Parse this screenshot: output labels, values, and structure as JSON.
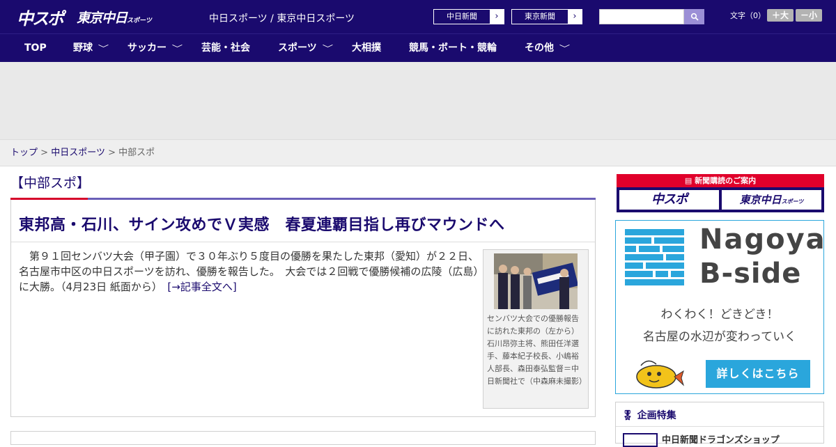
{
  "header": {
    "logo_chuspo": "中スポ",
    "logo_tokyo": "東京中日",
    "logo_tokyo_small": "スポーツ",
    "site_title": "中日スポーツ / 東京中日スポーツ",
    "paper_links": [
      {
        "label": "中日新聞"
      },
      {
        "label": "東京新聞"
      }
    ],
    "search": {
      "value": "",
      "icon": "search-icon"
    },
    "font_size": {
      "label": "文字（0）",
      "increase": "＋大",
      "decrease": "－小"
    }
  },
  "nav": {
    "items": [
      {
        "label": "TOP",
        "has_dropdown": false
      },
      {
        "label": "野球",
        "has_dropdown": true
      },
      {
        "label": "サッカー",
        "has_dropdown": true
      },
      {
        "label": "芸能・社会",
        "has_dropdown": false
      },
      {
        "label": "スポーツ",
        "has_dropdown": true
      },
      {
        "label": "大相撲",
        "has_dropdown": false
      },
      {
        "label": "競馬・ボート・競輪",
        "has_dropdown": false
      },
      {
        "label": "その他",
        "has_dropdown": true
      }
    ],
    "chevron": "﹀"
  },
  "breadcrumb": {
    "items": [
      "トップ",
      "中日スポーツ",
      "中部スポ"
    ],
    "separator": ">"
  },
  "main": {
    "section_heading": "【中部スポ】",
    "article": {
      "title": "東邦高・石川、サイン攻めでＶ実感　春夏連覇目指し再びマウンドへ",
      "body": "　第９１回センバツ大会（甲子園）で３０年ぶり５度目の優勝を果たした東邦（愛知）が２２日、名古屋市中区の中日スポーツを訪れ、優勝を報告した。　大会では２回戦で優勝候補の広陵（広島）に大勝。（4月23日 紙面から）　",
      "more_link": "[→記事全文へ]",
      "photo_caption": "センバツ大会での優勝報告に訪れた東邦の（左から）石川昂弥主将、熊田任洋選手、藤本紀子校長、小嶋裕人部長、森田泰弘監督＝中日新聞社で（中森麻未撮影）"
    }
  },
  "sidebar": {
    "subscription": {
      "heading": "新聞購読のご案内",
      "logo_chuspo": "中スポ",
      "logo_tokyo": "東京中日",
      "logo_tokyo_small": "スポーツ"
    },
    "bside_ad": {
      "title_line1": "Nagoya",
      "title_line2": "B-side",
      "sub_line1": "わくわく！どきどき！",
      "sub_line2": "名古屋の水辺が変わっていく",
      "button": "詳しくはこちら"
    },
    "feature": {
      "heading": "企画特集",
      "first_item": "中日新聞ドラゴンズショップ"
    }
  },
  "colors": {
    "brand_navy": "#1a0a6e",
    "accent_red": "#d6002a",
    "bside_blue": "#2aa6dc"
  }
}
